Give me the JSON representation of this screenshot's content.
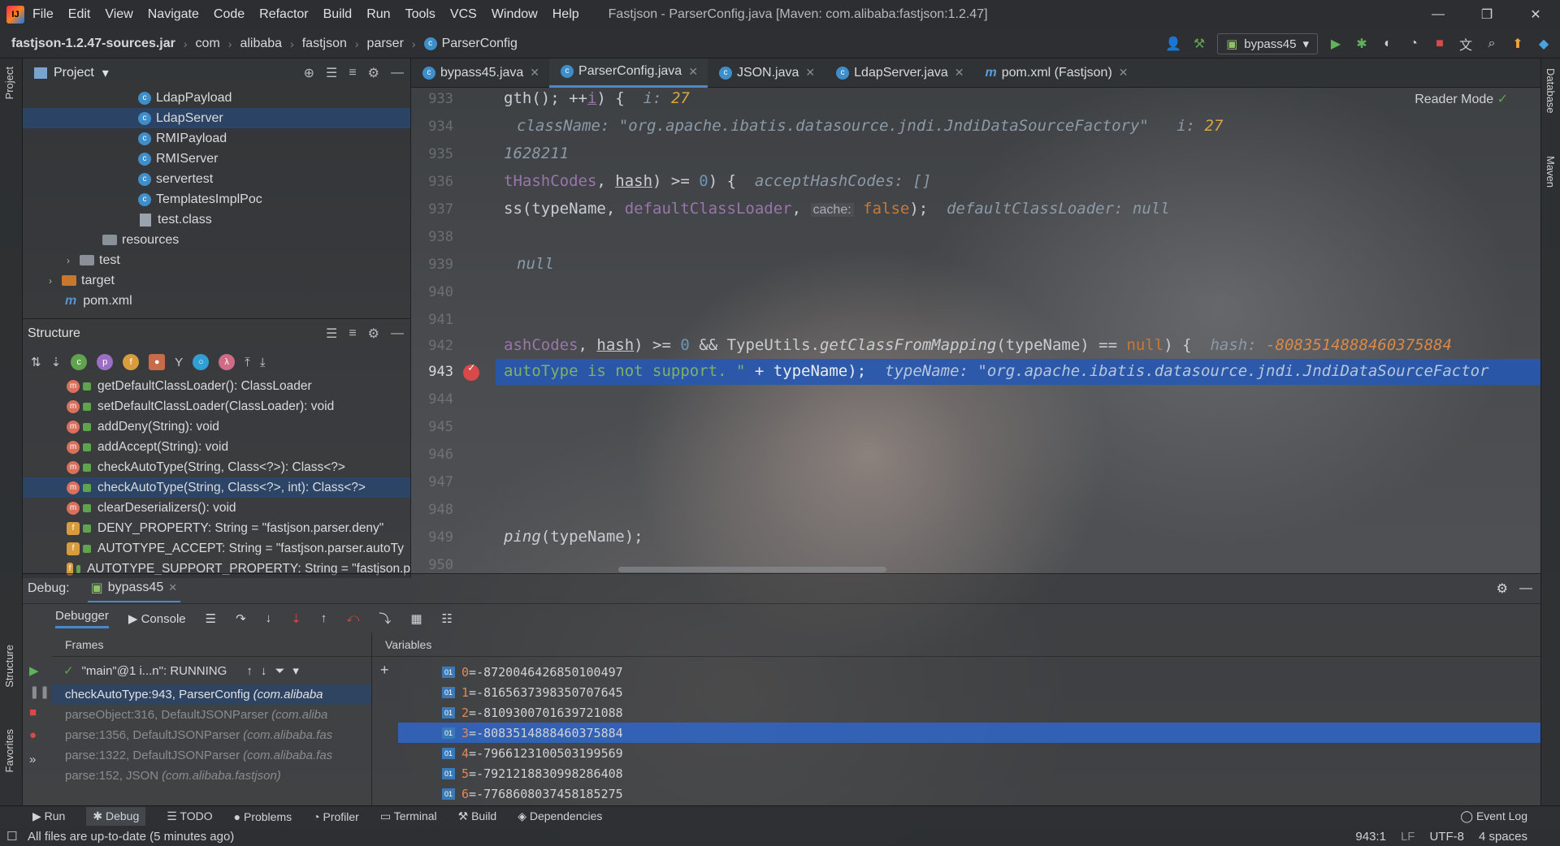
{
  "menubar": {
    "items": [
      "File",
      "Edit",
      "View",
      "Navigate",
      "Code",
      "Refactor",
      "Build",
      "Run",
      "Tools",
      "VCS",
      "Window",
      "Help"
    ],
    "window_title": "Fastjson - ParserConfig.java [Maven: com.alibaba:fastjson:1.2.47]"
  },
  "breadcrumb": [
    "fastjson-1.2.47-sources.jar",
    "com",
    "alibaba",
    "fastjson",
    "parser",
    "ParserConfig"
  ],
  "run_config": "bypass45",
  "project_panel": {
    "title": "Project",
    "items": [
      {
        "label": "LdapPayload",
        "type": "class",
        "depth": 5
      },
      {
        "label": "LdapServer",
        "type": "class",
        "depth": 5,
        "selected": true
      },
      {
        "label": "RMIPayload",
        "type": "class",
        "depth": 5
      },
      {
        "label": "RMIServer",
        "type": "class",
        "depth": 5
      },
      {
        "label": "servertest",
        "type": "class",
        "depth": 5
      },
      {
        "label": "TemplatesImplPoc",
        "type": "class",
        "depth": 5
      },
      {
        "label": "test.class",
        "type": "file",
        "depth": 5
      },
      {
        "label": "resources",
        "type": "folder",
        "depth": 4
      },
      {
        "label": "test",
        "type": "folder",
        "depth": 3
      },
      {
        "label": "target",
        "type": "folder-orange",
        "depth": 2
      },
      {
        "label": "pom.xml",
        "type": "maven",
        "depth": 2
      }
    ]
  },
  "structure_panel": {
    "title": "Structure",
    "members": [
      {
        "label": "getDefaultClassLoader(): ClassLoader",
        "kind": "m"
      },
      {
        "label": "setDefaultClassLoader(ClassLoader): void",
        "kind": "m"
      },
      {
        "label": "addDeny(String): void",
        "kind": "m"
      },
      {
        "label": "addAccept(String): void",
        "kind": "m"
      },
      {
        "label": "checkAutoType(String, Class<?>): Class<?>",
        "kind": "m"
      },
      {
        "label": "checkAutoType(String, Class<?>, int): Class<?>",
        "kind": "m",
        "selected": true
      },
      {
        "label": "clearDeserializers(): void",
        "kind": "m"
      },
      {
        "label": "DENY_PROPERTY: String = \"fastjson.parser.deny\"",
        "kind": "f"
      },
      {
        "label": "AUTOTYPE_ACCEPT: String = \"fastjson.parser.autoTy",
        "kind": "f"
      },
      {
        "label": "AUTOTYPE_SUPPORT_PROPERTY: String = \"fastjson.p",
        "kind": "f"
      }
    ]
  },
  "editor_tabs": [
    {
      "label": "bypass45.java",
      "icon": "class"
    },
    {
      "label": "ParserConfig.java",
      "icon": "class",
      "active": true
    },
    {
      "label": "JSON.java",
      "icon": "class-lock"
    },
    {
      "label": "LdapServer.java",
      "icon": "class"
    },
    {
      "label": "pom.xml (Fastjson)",
      "icon": "maven"
    }
  ],
  "reader_mode": "Reader Mode",
  "editor": {
    "line_numbers": [
      "933",
      "934",
      "935",
      "936",
      "937",
      "938",
      "939",
      "940",
      "941",
      "942",
      "943",
      "944",
      "945",
      "946",
      "947",
      "948",
      "949",
      "950"
    ],
    "current_line": "943",
    "lines": {
      "l933_code": "gth(); ++",
      "l933_i": "i",
      "l933_code2": ") {",
      "l933_hint_label": "i: ",
      "l933_hint_val": "27",
      "l934_hint": "className: \"org.apache.ibatis.datasource.jndi.JndiDataSourceFactory\"",
      "l934_hint2_label": "i: ",
      "l934_hint2_val": "27",
      "l935_hint": "1628211",
      "l936_a": "tHashCodes",
      "l936_b": ", ",
      "l936_c": "hash",
      "l936_d": ") >= ",
      "l936_e": "0",
      "l936_f": ") {",
      "l936_hint": "acceptHashCodes: []",
      "l937_a": "ss(typeName, ",
      "l937_b": "defaultClassLoader",
      "l937_c": ",",
      "l937_cache": "cache:",
      "l937_false": "false",
      "l937_d": ");",
      "l937_hint": "defaultClassLoader: null",
      "l939_hint": "null",
      "l942_a": "ashCodes",
      "l942_b": ", ",
      "l942_c": "hash",
      "l942_d": ") >= ",
      "l942_e": "0",
      "l942_f": " && TypeUtils.",
      "l942_g": "getClassFromMapping",
      "l942_h": "(typeName) == ",
      "l942_null": "null",
      "l942_i": ") {",
      "l942_hint_label": "hash: ",
      "l942_hint_val": "-8083514888460375884",
      "l943_str": "autoType is not support. \"",
      "l943_rest": " + typeName);",
      "l943_hint": "typeName: \"org.apache.ibatis.datasource.jndi.JndiDataSourceFactor",
      "l949_a": "ping",
      "l949_b": "(typeName);"
    }
  },
  "debug": {
    "label": "Debug:",
    "session": "bypass45",
    "tabs": [
      "Debugger",
      "Console"
    ],
    "frames_header": "Frames",
    "variables_header": "Variables",
    "thread": "\"main\"@1 i...n\": RUNNING",
    "frames": [
      {
        "method": "checkAutoType:943, ParserConfig",
        "pkg": "(com.alibaba",
        "selected": true
      },
      {
        "method": "parseObject:316, DefaultJSONParser",
        "pkg": "(com.aliba"
      },
      {
        "method": "parse:1356, DefaultJSONParser",
        "pkg": "(com.alibaba.fas"
      },
      {
        "method": "parse:1322, DefaultJSONParser",
        "pkg": "(com.alibaba.fas"
      },
      {
        "method": "parse:152, JSON",
        "pkg": "(com.alibaba.fastjson)"
      }
    ],
    "variables": [
      {
        "name": "0",
        "value": "-8720046426850100497"
      },
      {
        "name": "1",
        "value": "-8165637398350707645"
      },
      {
        "name": "2",
        "value": "-8109300701639721088"
      },
      {
        "name": "3",
        "value": "-8083514888460375884",
        "selected": true
      },
      {
        "name": "4",
        "value": "-7966123100503199569"
      },
      {
        "name": "5",
        "value": "-7921218830998286408"
      },
      {
        "name": "6",
        "value": "-7768608037458185275"
      }
    ]
  },
  "bottom_tools": [
    "Run",
    "Debug",
    "TODO",
    "Problems",
    "Profiler",
    "Terminal",
    "Build",
    "Dependencies"
  ],
  "event_log": "Event Log",
  "status": {
    "message": "All files are up-to-date (5 minutes ago)",
    "position": "943:1",
    "line_sep": "LF",
    "encoding": "UTF-8",
    "indent": "4 spaces"
  },
  "side_stripes": {
    "left_top": "Project",
    "left_bottom_1": "Structure",
    "left_bottom_2": "Favorites",
    "right_1": "Database",
    "right_2": "Maven"
  },
  "colors": {
    "selection": "#2a466e",
    "debug_highlight": "#2658b4",
    "breakpoint": "#d84a4a",
    "keyword": "#cc7832",
    "hint_number": "#d9a544"
  }
}
